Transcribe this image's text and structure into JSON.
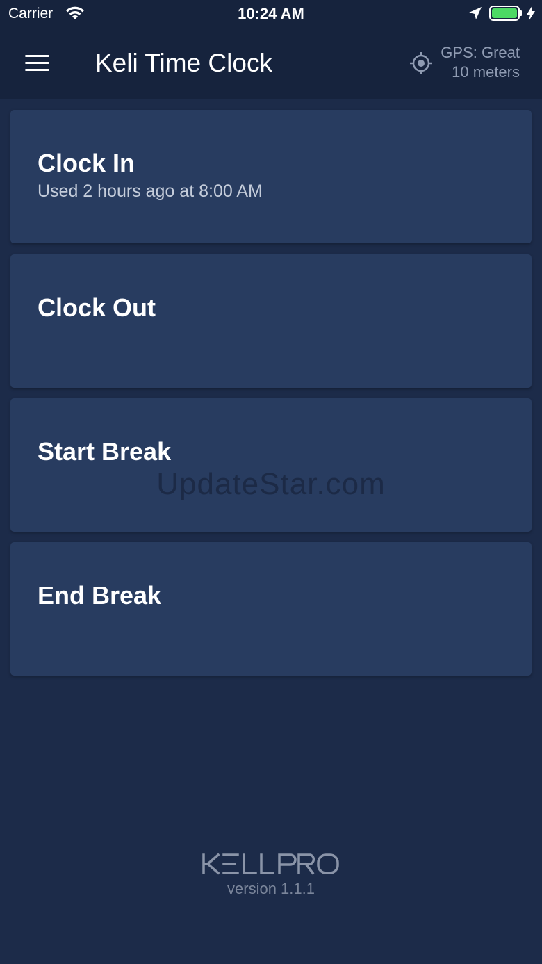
{
  "status_bar": {
    "carrier": "Carrier",
    "time": "10:24 AM",
    "icons": [
      "wifi-icon",
      "location-arrow-icon",
      "battery-icon",
      "charging-bolt-icon"
    ],
    "battery_color": "#4cd964"
  },
  "header": {
    "title": "Keli Time Clock",
    "gps_status": "GPS: Great",
    "gps_accuracy": "10 meters",
    "icons": [
      "menu-icon",
      "gps-target-icon"
    ]
  },
  "actions": [
    {
      "title": "Clock In",
      "subtitle": "Used 2 hours ago at 8:00 AM"
    },
    {
      "title": "Clock Out",
      "subtitle": ""
    },
    {
      "title": "Start Break",
      "subtitle": ""
    },
    {
      "title": "End Break",
      "subtitle": ""
    }
  ],
  "watermark": "UpdateStar.com",
  "footer": {
    "logo_text": "KELLPRO",
    "version": "version 1.1.1"
  },
  "colors": {
    "background": "#1c2b49",
    "header": "#16233d",
    "card": "#283c60",
    "muted_text": "#8f9bb2"
  }
}
